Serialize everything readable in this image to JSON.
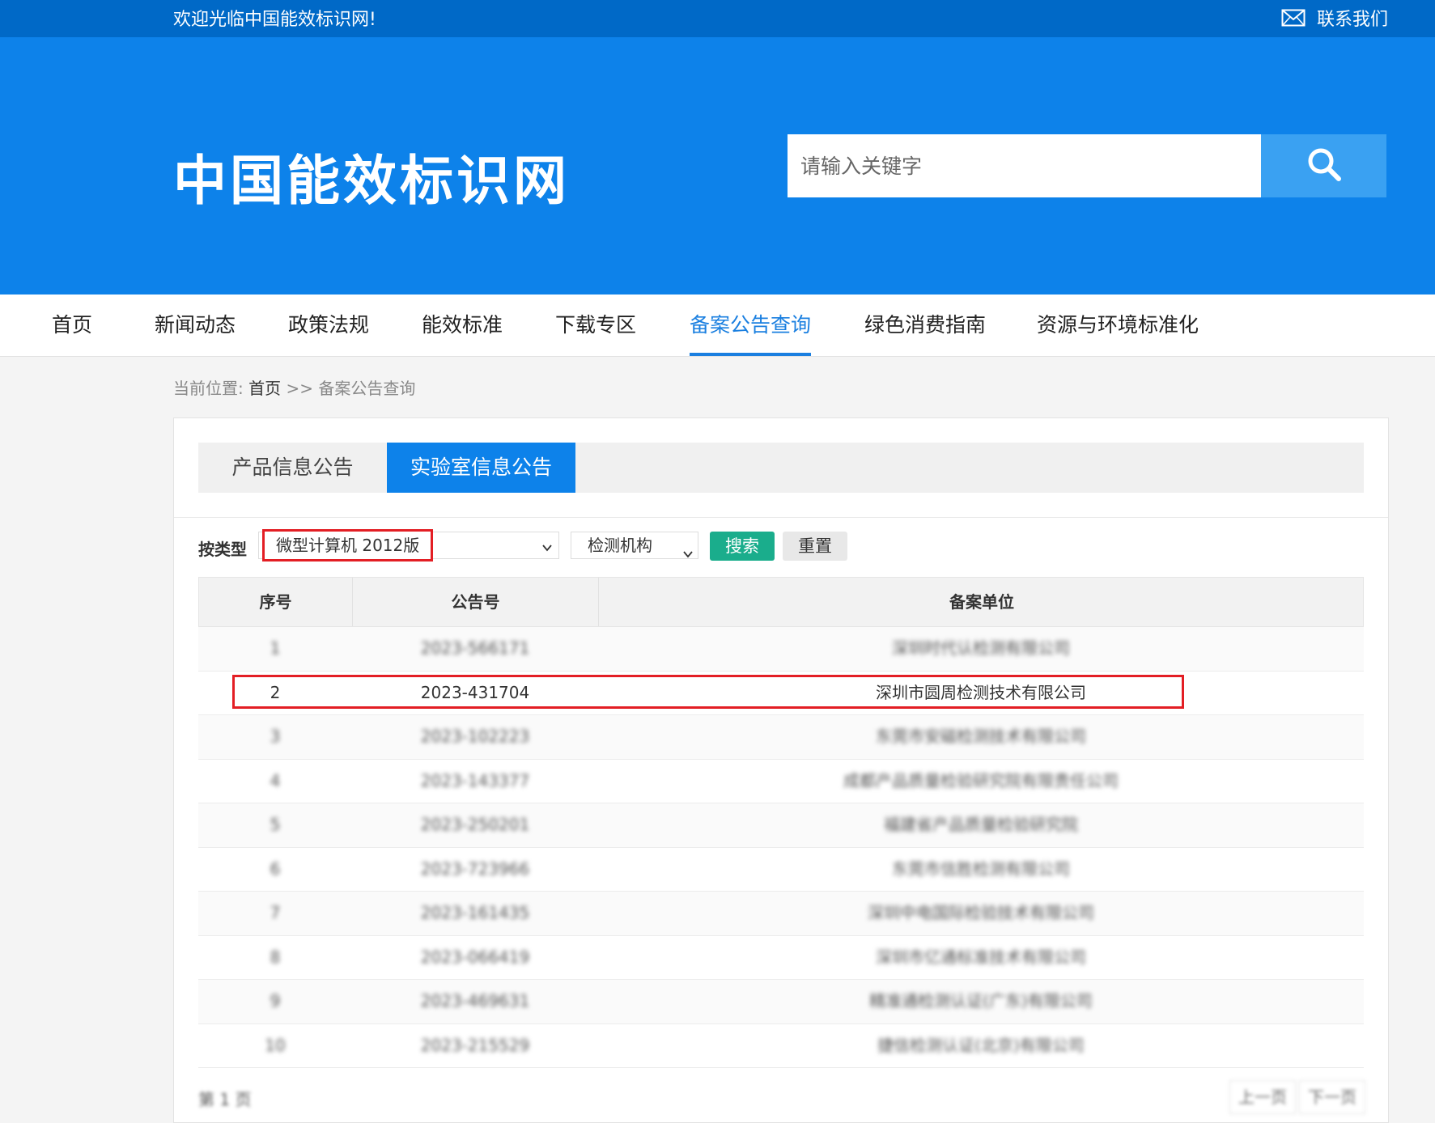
{
  "topbar": {
    "welcome": "欢迎光临中国能效标识网!",
    "contact": "联系我们",
    "contact_icon": "mail-icon"
  },
  "header": {
    "logo": "中国能效标识网",
    "search_placeholder": "请输入关键字",
    "search_icon": "search-icon"
  },
  "nav": {
    "items": [
      "首页",
      "新闻动态",
      "政策法规",
      "能效标准",
      "下载专区",
      "备案公告查询",
      "绿色消费指南",
      "资源与环境标准化"
    ],
    "active": "备案公告查询"
  },
  "breadcrumb": {
    "prefix": "当前位置:",
    "home": "首页",
    "sep": ">>",
    "current": "备案公告查询"
  },
  "tabs": [
    "产品信息公告",
    "实验室信息公告"
  ],
  "filters": {
    "label": "按类型",
    "type_value": "微型计算机 2012版",
    "org_value": "检测机构",
    "search_label": "搜索",
    "reset_label": "重置"
  },
  "table": {
    "headers": [
      "序号",
      "公告号",
      "备案单位"
    ],
    "rows": [
      [
        "1",
        "2023-566171",
        "深圳时代认检测有限公司"
      ],
      [
        "2",
        "2023-431704",
        "深圳市圆周检测技术有限公司"
      ],
      [
        "3",
        "2023-102223",
        "东莞市安磁检测技术有限公司"
      ],
      [
        "4",
        "2023-143377",
        "成都产品质量检验研究院有限责任公司"
      ],
      [
        "5",
        "2023-250201",
        "福建省产品质量检验研究院"
      ],
      [
        "6",
        "2023-723966",
        "东莞市信胜检测有限公司"
      ],
      [
        "7",
        "2023-161435",
        "深圳中电国际检验技术有限公司"
      ],
      [
        "8",
        "2023-066419",
        "深圳市亿通标准技术有限公司"
      ],
      [
        "9",
        "2023-469631",
        "精准通检测认证(广东)有限公司"
      ],
      [
        "10",
        "2023-215529",
        "捷信检测认证(北京)有限公司"
      ]
    ],
    "highlight_row": 2
  },
  "pager": {
    "page_prefix": "第",
    "page": "1",
    "page_suffix": "页",
    "prev": "上一页",
    "next": "下一页"
  },
  "colors": {
    "topbar": "#0069c7",
    "header": "#0d82ea",
    "accent": "#1a7fe0",
    "search_btn": "#3aa1f2",
    "highlight": "#e31e24",
    "green_btn": "#1aad8c"
  }
}
